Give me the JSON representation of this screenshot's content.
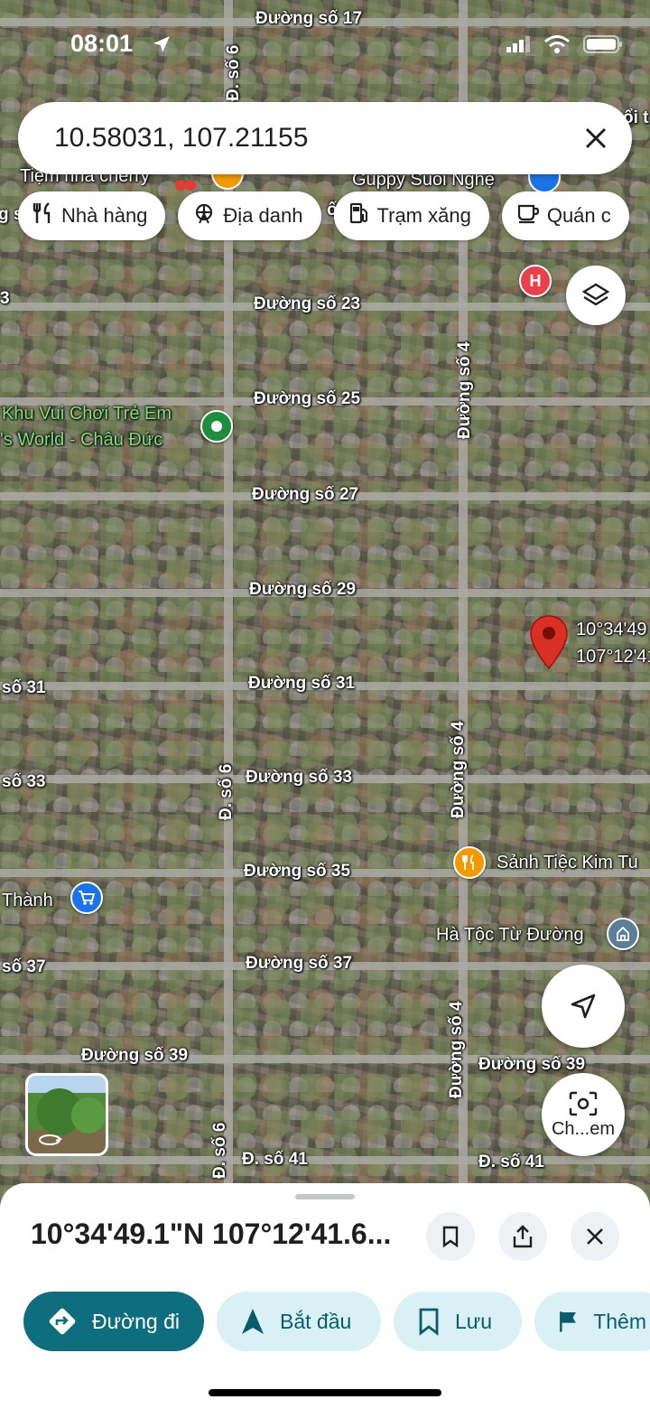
{
  "status_bar": {
    "time": "08:01"
  },
  "search": {
    "value": "10.58031, 107.21155"
  },
  "chips": [
    {
      "label": "Nhà hàng",
      "icon": "fork-knife-icon"
    },
    {
      "label": "Địa danh",
      "icon": "ferris-wheel-icon"
    },
    {
      "label": "Trạm xăng",
      "icon": "gas-pump-icon"
    },
    {
      "label": "Quán c",
      "icon": "coffee-cup-icon"
    }
  ],
  "map": {
    "street_labels": {
      "s17": "Đường số 17",
      "s23": "Đường số 23",
      "s25": "Đường số 25",
      "s27": "Đường số 27",
      "s29": "Đường số 29",
      "s31": "Đường số 31",
      "s31_left": "số 31",
      "s33": "Đường số 33",
      "s33_left": "số 33",
      "s35": "Đường số 35",
      "s37": "Đường số 37",
      "s37_left": "số 37",
      "s39": "Đường số 39",
      "s39_right": "Đường số 39",
      "s41": "Đ. số 41",
      "s41_right": "Đ. số 41",
      "d6_top": "Đ. số 6",
      "d6_mid": "Đ. số 6",
      "d6_bottom": "Đ. số 6",
      "d4_top": "Đường số 4",
      "d4_mid": "Đường số 4",
      "d4_bottom": "Đường số 4",
      "fragment_left": "g s",
      "fragment_mid": "ố 2",
      "fragment_3": "3",
      "fragment_toi": "ổi t"
    },
    "pois": {
      "cherry": "Tiệm nha cherry",
      "guppy": "Guppy Suối Nghệ",
      "kids1": "Khu Vui Chơi Trẻ Em",
      "kids2": "'s World - Châu Đức",
      "kimtu": "Sảnh Tiệc Kim Tu",
      "hatoc": "Hà Tộc Từ Đường",
      "thanh": "Thành"
    },
    "pin_coords": {
      "line1": "10°34'49",
      "line2": "107°12'41"
    }
  },
  "camera_button": {
    "label": "Ch...em"
  },
  "sheet": {
    "title": "10°34'49.1\"N 107°12'41.6...",
    "actions": [
      {
        "label": "Đường đi",
        "icon": "directions-icon"
      },
      {
        "label": "Bắt đầu",
        "icon": "navigation-arrow-icon"
      },
      {
        "label": "Lưu",
        "icon": "bookmark-icon"
      },
      {
        "label": "Thêm",
        "icon": "flag-icon"
      }
    ]
  },
  "colors": {
    "accent": "#0e6e7e",
    "pin": "#d93025",
    "hospital": "#e8414b",
    "shop": "#1a73e8",
    "food": "#f29900"
  }
}
